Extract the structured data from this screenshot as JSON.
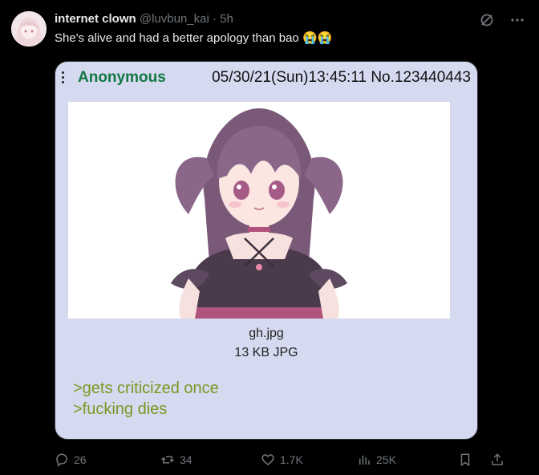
{
  "tweet": {
    "display_name": "internet clown",
    "handle": "@luvbun_kai",
    "separator": "·",
    "time": "5h",
    "text": "She's alive and had a better apology than bao",
    "emoji": "😭😭"
  },
  "post": {
    "poster": "Anonymous",
    "meta": "05/30/21(Sun)13:45:11 No.123440443",
    "file_name": "gh.jpg",
    "file_info": "13 KB JPG",
    "lines": [
      ">gets criticized once",
      ">fucking dies"
    ]
  },
  "actions": {
    "replies": "26",
    "reposts": "34",
    "likes": "1.7K",
    "views": "25K"
  },
  "icons": {
    "top_right": [
      "grok-icon",
      "more-icon"
    ],
    "action_bar": [
      "reply-icon",
      "retweet-icon",
      "like-icon",
      "views-icon",
      "bookmark-icon",
      "share-icon"
    ]
  },
  "colors": {
    "background": "#000000",
    "text": "#e7e9ea",
    "muted": "#71767b",
    "post_bg": "#d6daf0",
    "poster_name": "#117743",
    "greentext": "#789922"
  }
}
